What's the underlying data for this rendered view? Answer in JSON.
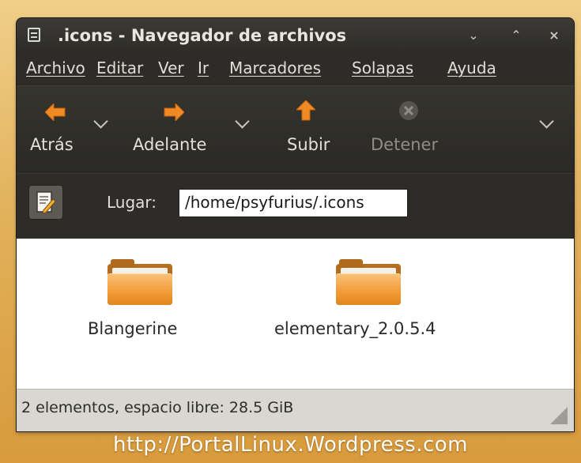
{
  "window": {
    "title": ".icons - Navegador de archivos",
    "controls": {
      "minimize": "⌄",
      "maximize": "⌃",
      "close": "×"
    }
  },
  "menubar": {
    "items": [
      {
        "label": "Archivo",
        "accesskey": "A"
      },
      {
        "label": "Editar",
        "accesskey": "E"
      },
      {
        "label": "Ver",
        "accesskey": "V"
      },
      {
        "label": "Ir",
        "accesskey": "I"
      },
      {
        "label": "Marcadores",
        "accesskey": "M"
      },
      {
        "label": "Solapas",
        "accesskey": "S"
      },
      {
        "label": "Ayuda",
        "accesskey": "u"
      }
    ]
  },
  "toolbar": {
    "back_label": "Atrás",
    "forward_label": "Adelante",
    "up_label": "Subir",
    "stop_label": "Detener",
    "accent_color": "#f08a24",
    "disabled_color": "#8e8c86"
  },
  "location": {
    "label": "Lugar:",
    "path": "/home/psyfurius/.icons"
  },
  "files": [
    {
      "name": "Blangerine",
      "icon": "folder-icon"
    },
    {
      "name": "elementary_2.0.5.4",
      "icon": "folder-icon"
    }
  ],
  "status": {
    "text": "2 elementos, espacio libre: 28.5 GiB"
  },
  "watermark": {
    "text": "http://PortalLinux.Wordpress.com"
  }
}
